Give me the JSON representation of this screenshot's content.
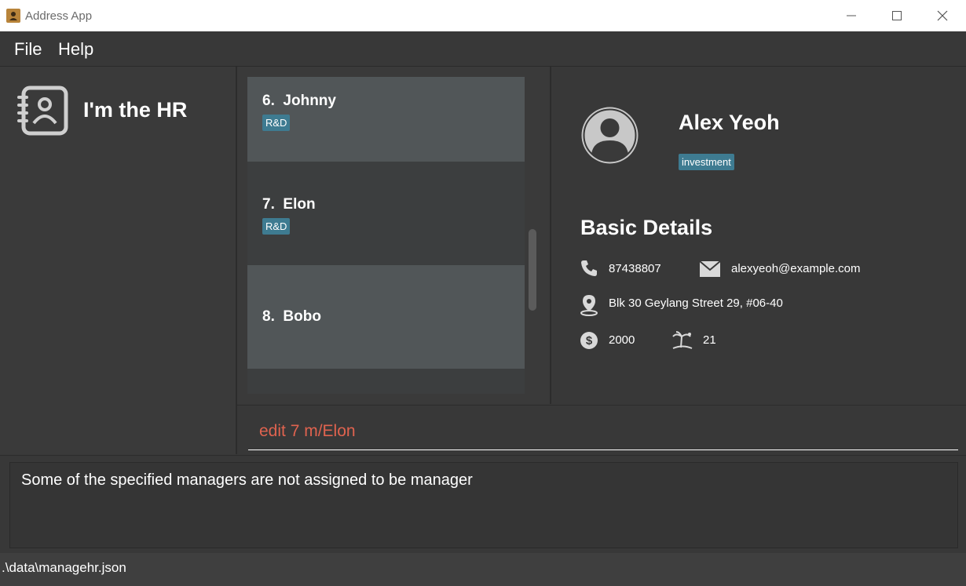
{
  "window": {
    "title": "Address App",
    "controls": {
      "minimize": "—",
      "maximize": "☐",
      "close": "✕"
    }
  },
  "menu": {
    "file": "File",
    "help": "Help"
  },
  "sidebar": {
    "title": "I'm the HR",
    "icon": "contact-book-icon"
  },
  "person_list": [
    {
      "index": "6.",
      "name": "Johnny",
      "tag": "R&D"
    },
    {
      "index": "7.",
      "name": "Elon",
      "tag": "R&D"
    },
    {
      "index": "8.",
      "name": "Bobo",
      "tag": ""
    }
  ],
  "detail": {
    "name": "Alex Yeoh",
    "tag": "investment",
    "heading": "Basic Details",
    "phone": "87438807",
    "email": "alexyeoh@example.com",
    "address": "Blk 30 Geylang Street 29, #06-40",
    "salary": "2000",
    "leave": "21",
    "icons": {
      "phone": "phone-icon",
      "email": "mail-icon",
      "address": "location-pin-icon",
      "salary": "dollar-icon",
      "leave": "island-icon"
    }
  },
  "command": {
    "value": "edit 7 m/Elon"
  },
  "result": {
    "message": "Some of the specified managers are not assigned to be manager"
  },
  "status": {
    "path": ".\\data\\managehr.json"
  },
  "colors": {
    "tag": "#3e7b91",
    "command_text": "#e0634f",
    "background": "#383838"
  }
}
